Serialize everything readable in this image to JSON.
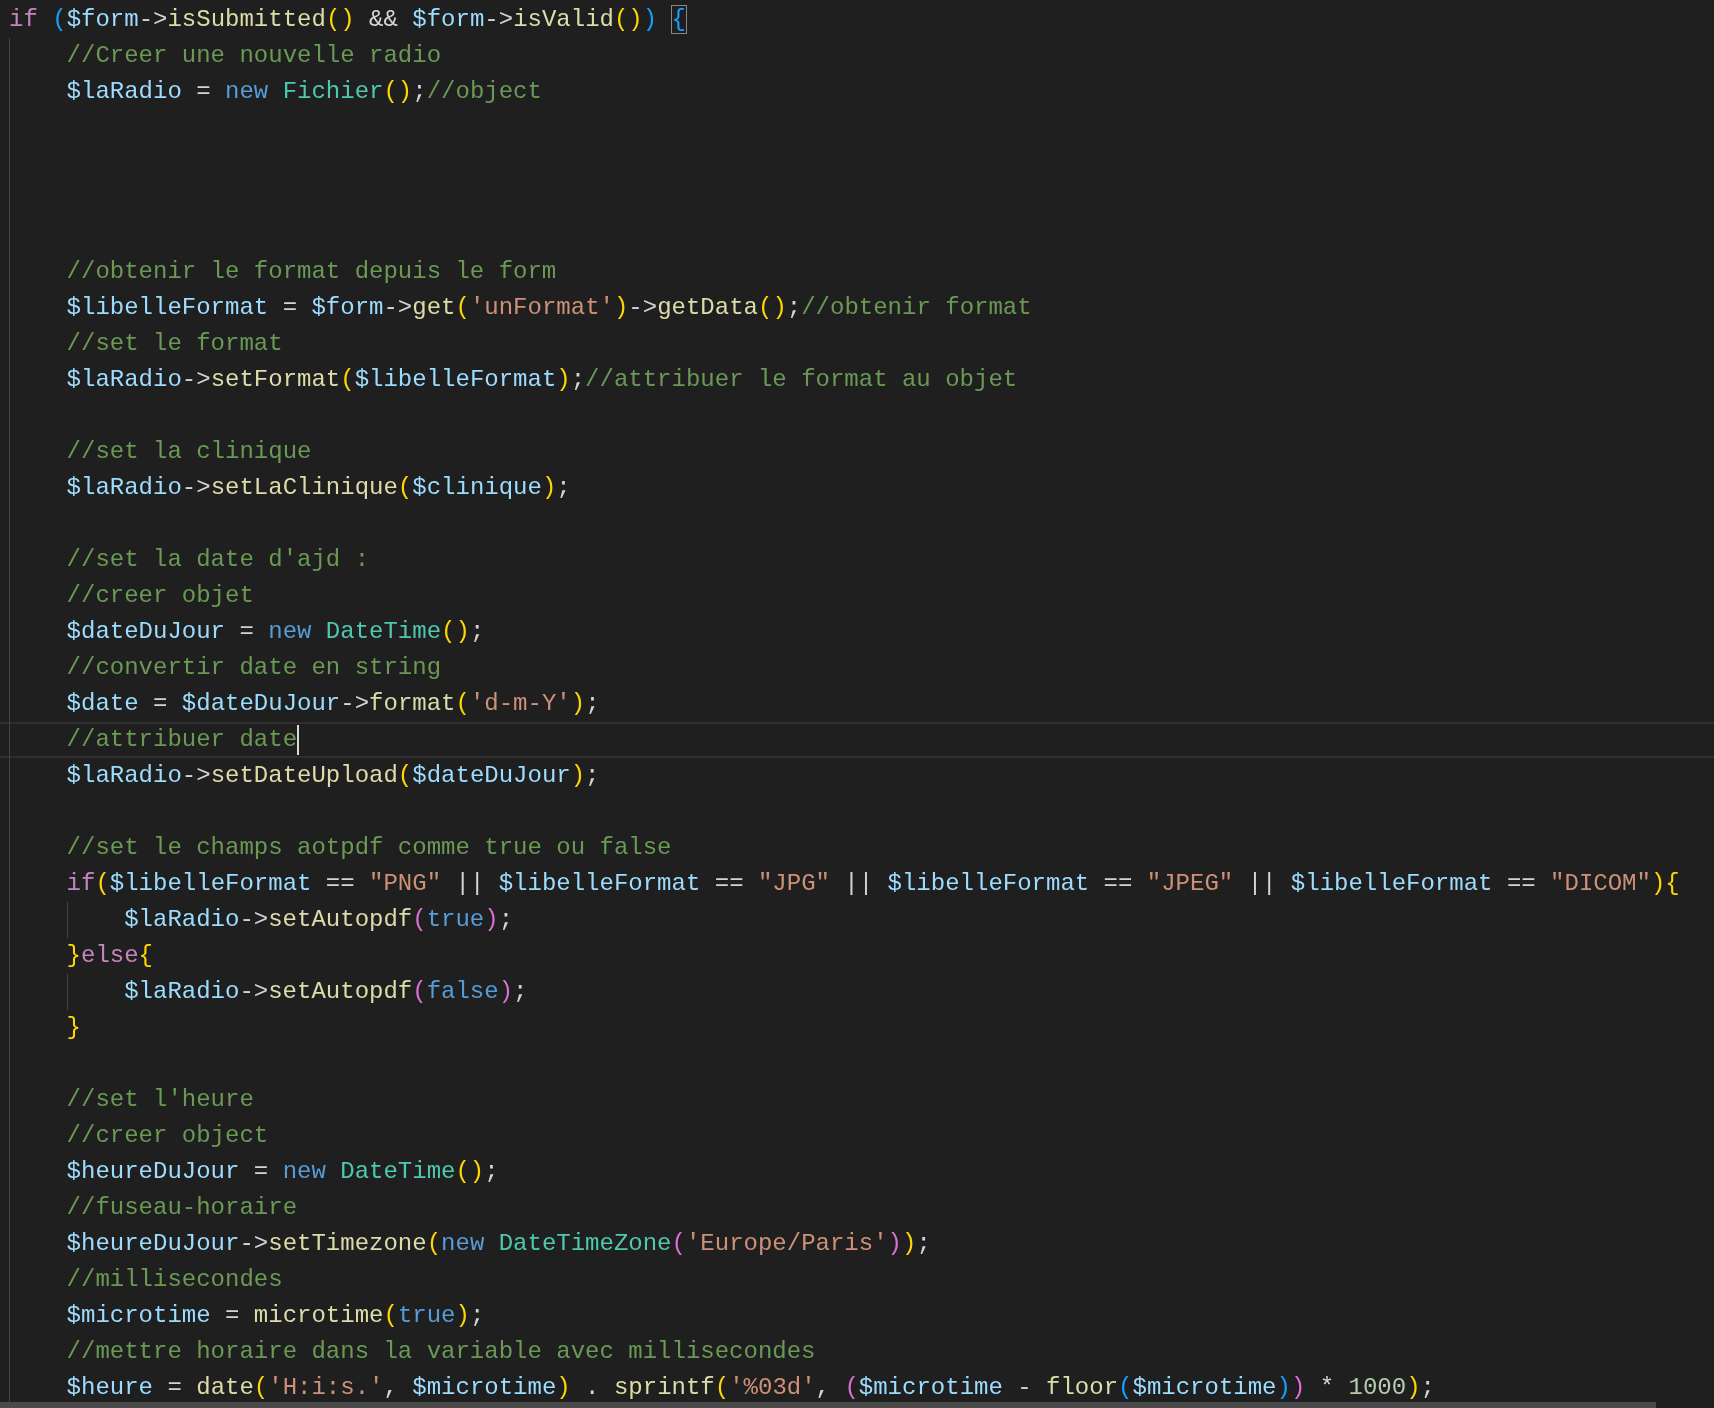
{
  "editor": {
    "lines": [
      {
        "current": false,
        "tokens": [
          {
            "kind": "k",
            "text": "if "
          },
          {
            "kind": "b3",
            "text": "("
          },
          {
            "kind": "v",
            "text": "$form"
          },
          {
            "kind": "o",
            "text": "->"
          },
          {
            "kind": "f",
            "text": "isSubmitted"
          },
          {
            "kind": "b1",
            "text": "()"
          },
          {
            "kind": "o",
            "text": " && "
          },
          {
            "kind": "v",
            "text": "$form"
          },
          {
            "kind": "o",
            "text": "->"
          },
          {
            "kind": "f",
            "text": "isValid"
          },
          {
            "kind": "b1",
            "text": "()"
          },
          {
            "kind": "b3",
            "text": ") "
          },
          {
            "kind": "m",
            "text": "{"
          }
        ],
        "children": [
          {
            "current": false,
            "tokens": [
              {
                "kind": "c",
                "text": "//Creer une nouvelle radio"
              }
            ]
          },
          {
            "current": false,
            "tokens": [
              {
                "kind": "v",
                "text": "$laRadio"
              },
              {
                "kind": "o",
                "text": " = "
              },
              {
                "kind": "n",
                "text": "new "
              },
              {
                "kind": "t",
                "text": "Fichier"
              },
              {
                "kind": "b1",
                "text": "()"
              },
              {
                "kind": "o",
                "text": ";"
              },
              {
                "kind": "c",
                "text": "//object"
              }
            ]
          },
          {
            "current": false
          },
          {
            "current": false
          },
          {
            "current": false
          },
          {
            "current": false
          },
          {
            "current": false,
            "tokens": [
              {
                "kind": "c",
                "text": "//obtenir le format depuis le form"
              }
            ]
          },
          {
            "current": false,
            "tokens": [
              {
                "kind": "v",
                "text": "$libelleFormat"
              },
              {
                "kind": "o",
                "text": " = "
              },
              {
                "kind": "v",
                "text": "$form"
              },
              {
                "kind": "o",
                "text": "->"
              },
              {
                "kind": "f",
                "text": "get"
              },
              {
                "kind": "b1",
                "text": "("
              },
              {
                "kind": "s",
                "text": "'unFormat'"
              },
              {
                "kind": "b1",
                "text": ")"
              },
              {
                "kind": "o",
                "text": "->"
              },
              {
                "kind": "f",
                "text": "getData"
              },
              {
                "kind": "b1",
                "text": "()"
              },
              {
                "kind": "o",
                "text": ";"
              },
              {
                "kind": "c",
                "text": "//obtenir format"
              }
            ]
          },
          {
            "current": false,
            "tokens": [
              {
                "kind": "c",
                "text": "//set le format"
              }
            ]
          },
          {
            "current": false,
            "tokens": [
              {
                "kind": "v",
                "text": "$laRadio"
              },
              {
                "kind": "o",
                "text": "->"
              },
              {
                "kind": "f",
                "text": "setFormat"
              },
              {
                "kind": "b1",
                "text": "("
              },
              {
                "kind": "v",
                "text": "$libelleFormat"
              },
              {
                "kind": "b1",
                "text": ")"
              },
              {
                "kind": "o",
                "text": ";"
              },
              {
                "kind": "c",
                "text": "//attribuer le format au objet"
              }
            ]
          },
          {
            "current": false
          },
          {
            "current": false,
            "tokens": [
              {
                "kind": "c",
                "text": "//set la clinique"
              }
            ]
          },
          {
            "current": false,
            "tokens": [
              {
                "kind": "v",
                "text": "$laRadio"
              },
              {
                "kind": "o",
                "text": "->"
              },
              {
                "kind": "f",
                "text": "setLaClinique"
              },
              {
                "kind": "b1",
                "text": "("
              },
              {
                "kind": "v",
                "text": "$clinique"
              },
              {
                "kind": "b1",
                "text": ")"
              },
              {
                "kind": "o",
                "text": ";"
              }
            ]
          },
          {
            "current": false
          },
          {
            "current": false,
            "tokens": [
              {
                "kind": "c",
                "text": "//set la date d'ajd :"
              }
            ]
          },
          {
            "current": false,
            "tokens": [
              {
                "kind": "c",
                "text": "//creer objet"
              }
            ]
          },
          {
            "current": false,
            "tokens": [
              {
                "kind": "v",
                "text": "$dateDuJour"
              },
              {
                "kind": "o",
                "text": " = "
              },
              {
                "kind": "n",
                "text": "new "
              },
              {
                "kind": "t",
                "text": "DateTime"
              },
              {
                "kind": "b1",
                "text": "()"
              },
              {
                "kind": "o",
                "text": ";"
              }
            ]
          },
          {
            "current": false,
            "tokens": [
              {
                "kind": "c",
                "text": "//convertir date en string"
              }
            ]
          },
          {
            "current": false,
            "tokens": [
              {
                "kind": "v",
                "text": "$date"
              },
              {
                "kind": "o",
                "text": " = "
              },
              {
                "kind": "v",
                "text": "$dateDuJour"
              },
              {
                "kind": "o",
                "text": "->"
              },
              {
                "kind": "f",
                "text": "format"
              },
              {
                "kind": "b1",
                "text": "("
              },
              {
                "kind": "s",
                "text": "'d-m-Y'"
              },
              {
                "kind": "b1",
                "text": ")"
              },
              {
                "kind": "o",
                "text": ";"
              }
            ]
          },
          {
            "current": true,
            "tokens": [
              {
                "kind": "c",
                "text": "//attribuer date"
              }
            ]
          },
          {
            "current": false,
            "tokens": [
              {
                "kind": "v",
                "text": "$laRadio"
              },
              {
                "kind": "o",
                "text": "->"
              },
              {
                "kind": "f",
                "text": "setDateUpload"
              },
              {
                "kind": "b1",
                "text": "("
              },
              {
                "kind": "v",
                "text": "$dateDuJour"
              },
              {
                "kind": "b1",
                "text": ")"
              },
              {
                "kind": "o",
                "text": ";"
              }
            ]
          },
          {
            "current": false
          },
          {
            "current": false,
            "tokens": [
              {
                "kind": "c",
                "text": "//set le champs aotpdf comme true ou false"
              }
            ]
          },
          {
            "current": false,
            "tokens": [
              {
                "kind": "k",
                "text": "if"
              },
              {
                "kind": "b1",
                "text": "("
              },
              {
                "kind": "v",
                "text": "$libelleFormat"
              },
              {
                "kind": "o",
                "text": " == "
              },
              {
                "kind": "s",
                "text": "\"PNG\""
              },
              {
                "kind": "o",
                "text": " || "
              },
              {
                "kind": "v",
                "text": "$libelleFormat"
              },
              {
                "kind": "o",
                "text": " == "
              },
              {
                "kind": "s",
                "text": "\"JPG\""
              },
              {
                "kind": "o",
                "text": " || "
              },
              {
                "kind": "v",
                "text": "$libelleFormat"
              },
              {
                "kind": "o",
                "text": " == "
              },
              {
                "kind": "s",
                "text": "\"JPEG\""
              },
              {
                "kind": "o",
                "text": " || "
              },
              {
                "kind": "v",
                "text": "$libelleFormat"
              },
              {
                "kind": "o",
                "text": " == "
              },
              {
                "kind": "s",
                "text": "\"DICOM\""
              },
              {
                "kind": "b1",
                "text": "){"
              }
            ],
            "children": [
              {
                "current": false,
                "tokens": [
                  {
                    "kind": "v",
                    "text": "$laRadio"
                  },
                  {
                    "kind": "o",
                    "text": "->"
                  },
                  {
                    "kind": "f",
                    "text": "setAutopdf"
                  },
                  {
                    "kind": "b2",
                    "text": "("
                  },
                  {
                    "kind": "n",
                    "text": "true"
                  },
                  {
                    "kind": "b2",
                    "text": ")"
                  },
                  {
                    "kind": "o",
                    "text": ";"
                  }
                ]
              }
            ]
          },
          {
            "current": false,
            "tokens": [
              {
                "kind": "b1",
                "text": "}"
              },
              {
                "kind": "k",
                "text": "else"
              },
              {
                "kind": "b1",
                "text": "{"
              }
            ],
            "children": [
              {
                "current": false,
                "tokens": [
                  {
                    "kind": "v",
                    "text": "$laRadio"
                  },
                  {
                    "kind": "o",
                    "text": "->"
                  },
                  {
                    "kind": "f",
                    "text": "setAutopdf"
                  },
                  {
                    "kind": "b2",
                    "text": "("
                  },
                  {
                    "kind": "n",
                    "text": "false"
                  },
                  {
                    "kind": "b2",
                    "text": ")"
                  },
                  {
                    "kind": "o",
                    "text": ";"
                  }
                ]
              }
            ]
          },
          {
            "current": false,
            "tokens": [
              {
                "kind": "b1",
                "text": "}"
              }
            ]
          },
          {
            "current": false
          },
          {
            "current": false,
            "tokens": [
              {
                "kind": "c",
                "text": "//set l'heure"
              }
            ]
          },
          {
            "current": false,
            "tokens": [
              {
                "kind": "c",
                "text": "//creer object"
              }
            ]
          },
          {
            "current": false,
            "tokens": [
              {
                "kind": "v",
                "text": "$heureDuJour"
              },
              {
                "kind": "o",
                "text": " = "
              },
              {
                "kind": "n",
                "text": "new "
              },
              {
                "kind": "t",
                "text": "DateTime"
              },
              {
                "kind": "b1",
                "text": "()"
              },
              {
                "kind": "o",
                "text": ";"
              }
            ]
          },
          {
            "current": false,
            "tokens": [
              {
                "kind": "c",
                "text": "//fuseau-horaire"
              }
            ]
          },
          {
            "current": false,
            "tokens": [
              {
                "kind": "v",
                "text": "$heureDuJour"
              },
              {
                "kind": "o",
                "text": "->"
              },
              {
                "kind": "f",
                "text": "setTimezone"
              },
              {
                "kind": "b1",
                "text": "("
              },
              {
                "kind": "n",
                "text": "new "
              },
              {
                "kind": "t",
                "text": "DateTimeZone"
              },
              {
                "kind": "b2",
                "text": "("
              },
              {
                "kind": "s",
                "text": "'Europe/Paris'"
              },
              {
                "kind": "b2",
                "text": ")"
              },
              {
                "kind": "b1",
                "text": ")"
              },
              {
                "kind": "o",
                "text": ";"
              }
            ]
          },
          {
            "current": false,
            "tokens": [
              {
                "kind": "c",
                "text": "//millisecondes"
              }
            ]
          },
          {
            "current": false,
            "tokens": [
              {
                "kind": "v",
                "text": "$microtime"
              },
              {
                "kind": "o",
                "text": " = "
              },
              {
                "kind": "f",
                "text": "microtime"
              },
              {
                "kind": "b1",
                "text": "("
              },
              {
                "kind": "n",
                "text": "true"
              },
              {
                "kind": "b1",
                "text": ")"
              },
              {
                "kind": "o",
                "text": ";"
              }
            ]
          },
          {
            "current": false,
            "tokens": [
              {
                "kind": "c",
                "text": "//mettre horaire dans la variable avec millisecondes"
              }
            ]
          },
          {
            "current": false,
            "tokens": [
              {
                "kind": "v",
                "text": "$heure"
              },
              {
                "kind": "o",
                "text": " = "
              },
              {
                "kind": "f",
                "text": "date"
              },
              {
                "kind": "b1",
                "text": "("
              },
              {
                "kind": "s",
                "text": "'H:i:s.'"
              },
              {
                "kind": "o",
                "text": ", "
              },
              {
                "kind": "v",
                "text": "$microtime"
              },
              {
                "kind": "b1",
                "text": ")"
              },
              {
                "kind": "o",
                "text": " . "
              },
              {
                "kind": "f",
                "text": "sprintf"
              },
              {
                "kind": "b1",
                "text": "("
              },
              {
                "kind": "s",
                "text": "'%03d'"
              },
              {
                "kind": "o",
                "text": ", "
              },
              {
                "kind": "b2",
                "text": "("
              },
              {
                "kind": "v",
                "text": "$microtime"
              },
              {
                "kind": "o",
                "text": " - "
              },
              {
                "kind": "f",
                "text": "floor"
              },
              {
                "kind": "b3",
                "text": "("
              },
              {
                "kind": "v",
                "text": "$microtime"
              },
              {
                "kind": "b3",
                "text": ")"
              },
              {
                "kind": "b2",
                "text": ")"
              },
              {
                "kind": "o",
                "text": " * "
              },
              {
                "kind": "num",
                "text": "1000"
              },
              {
                "kind": "b1",
                "text": ")"
              },
              {
                "kind": "o",
                "text": ";"
              }
            ]
          }
        ]
      }
    ]
  }
}
